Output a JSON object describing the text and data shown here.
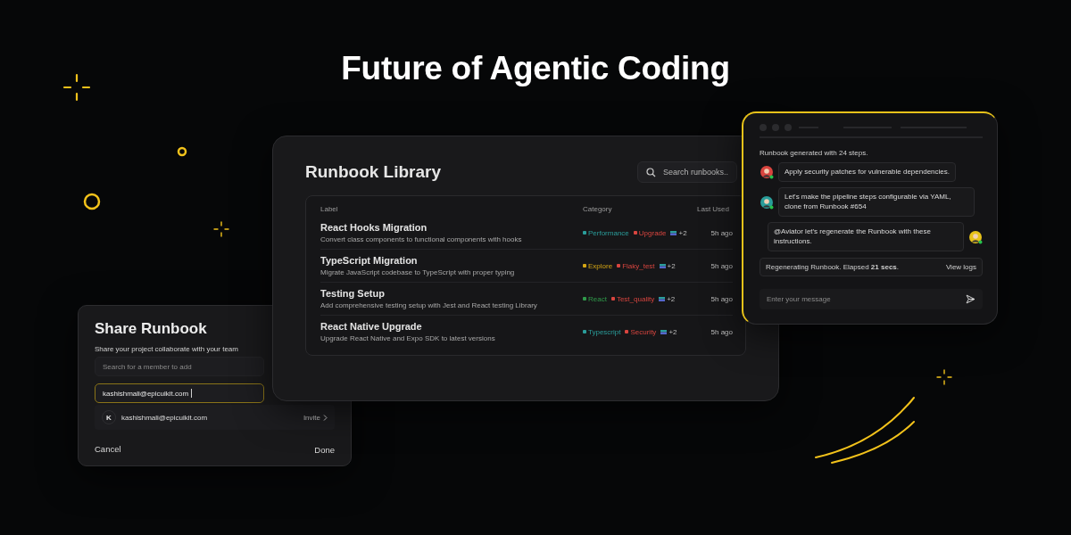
{
  "headline": "Future of Agentic Coding",
  "library": {
    "title": "Runbook Library",
    "search": {
      "placeholder": "Search runbooks.."
    },
    "columns": [
      "Label",
      "Category",
      "Last Used"
    ],
    "rows": [
      {
        "title": "React Hooks Migration",
        "description": "Convert class components to functional components with hooks",
        "tags": [
          {
            "label": "Performance",
            "color": "#2a9d9a"
          },
          {
            "label": "Upgrade",
            "color": "#d9453f"
          }
        ],
        "more": "+2",
        "last_used": "5h ago"
      },
      {
        "title": "TypeScript Migration",
        "description": "Migrate JavaScript codebase to TypeScript with proper typing",
        "tags": [
          {
            "label": "Explore",
            "color": "#d4a514"
          },
          {
            "label": "Flaky_test",
            "color": "#d9453f"
          }
        ],
        "more": "+2",
        "last_used": "5h ago"
      },
      {
        "title": "Testing Setup",
        "description": "Add comprehensive testing setup with Jest and React testing Library",
        "tags": [
          {
            "label": "React",
            "color": "#2f9a4a"
          },
          {
            "label": "Test_quality",
            "color": "#d9453f"
          }
        ],
        "more": "+2",
        "last_used": "5h ago"
      },
      {
        "title": "React Native Upgrade",
        "description": "Upgrade React Native and Expo SDK to latest versions",
        "tags": [
          {
            "label": "Typescript",
            "color": "#2a9d9a"
          },
          {
            "label": "Security",
            "color": "#d9453f"
          }
        ],
        "more": "+2",
        "last_used": "5h ago"
      }
    ]
  },
  "chat": {
    "status": "Runbook generated with 24 steps.",
    "messages": [
      {
        "text": "Apply security patches for vulnerable dependencies.",
        "kind": "received",
        "color": "#d9453f"
      },
      {
        "text": "Let's make the pipeline steps configurable via YAML, clone from Runbook #654",
        "kind": "received",
        "color": "#2a9d9a"
      },
      {
        "text": "@Aviator let's regenerate the Runbook with these instructions.",
        "kind": "sent",
        "color": "#e8c21a"
      }
    ],
    "progress": {
      "text": "Regenerating Runbook. Elapsed **21 secs**.",
      "action": "View logs"
    },
    "input": {
      "placeholder": "Enter your message"
    }
  },
  "share": {
    "title": "Share Runbook",
    "subtitle": "Share your project collaborate with your team",
    "search": {
      "placeholder": "Search for a member to add"
    },
    "email": {
      "value": "kashishmali@epicuikit.com"
    },
    "suggestion": {
      "initial": "K",
      "email": "kashishmali@epicuikit.com",
      "action": "Invite"
    },
    "buttons": [
      "Cancel",
      "Done"
    ]
  }
}
